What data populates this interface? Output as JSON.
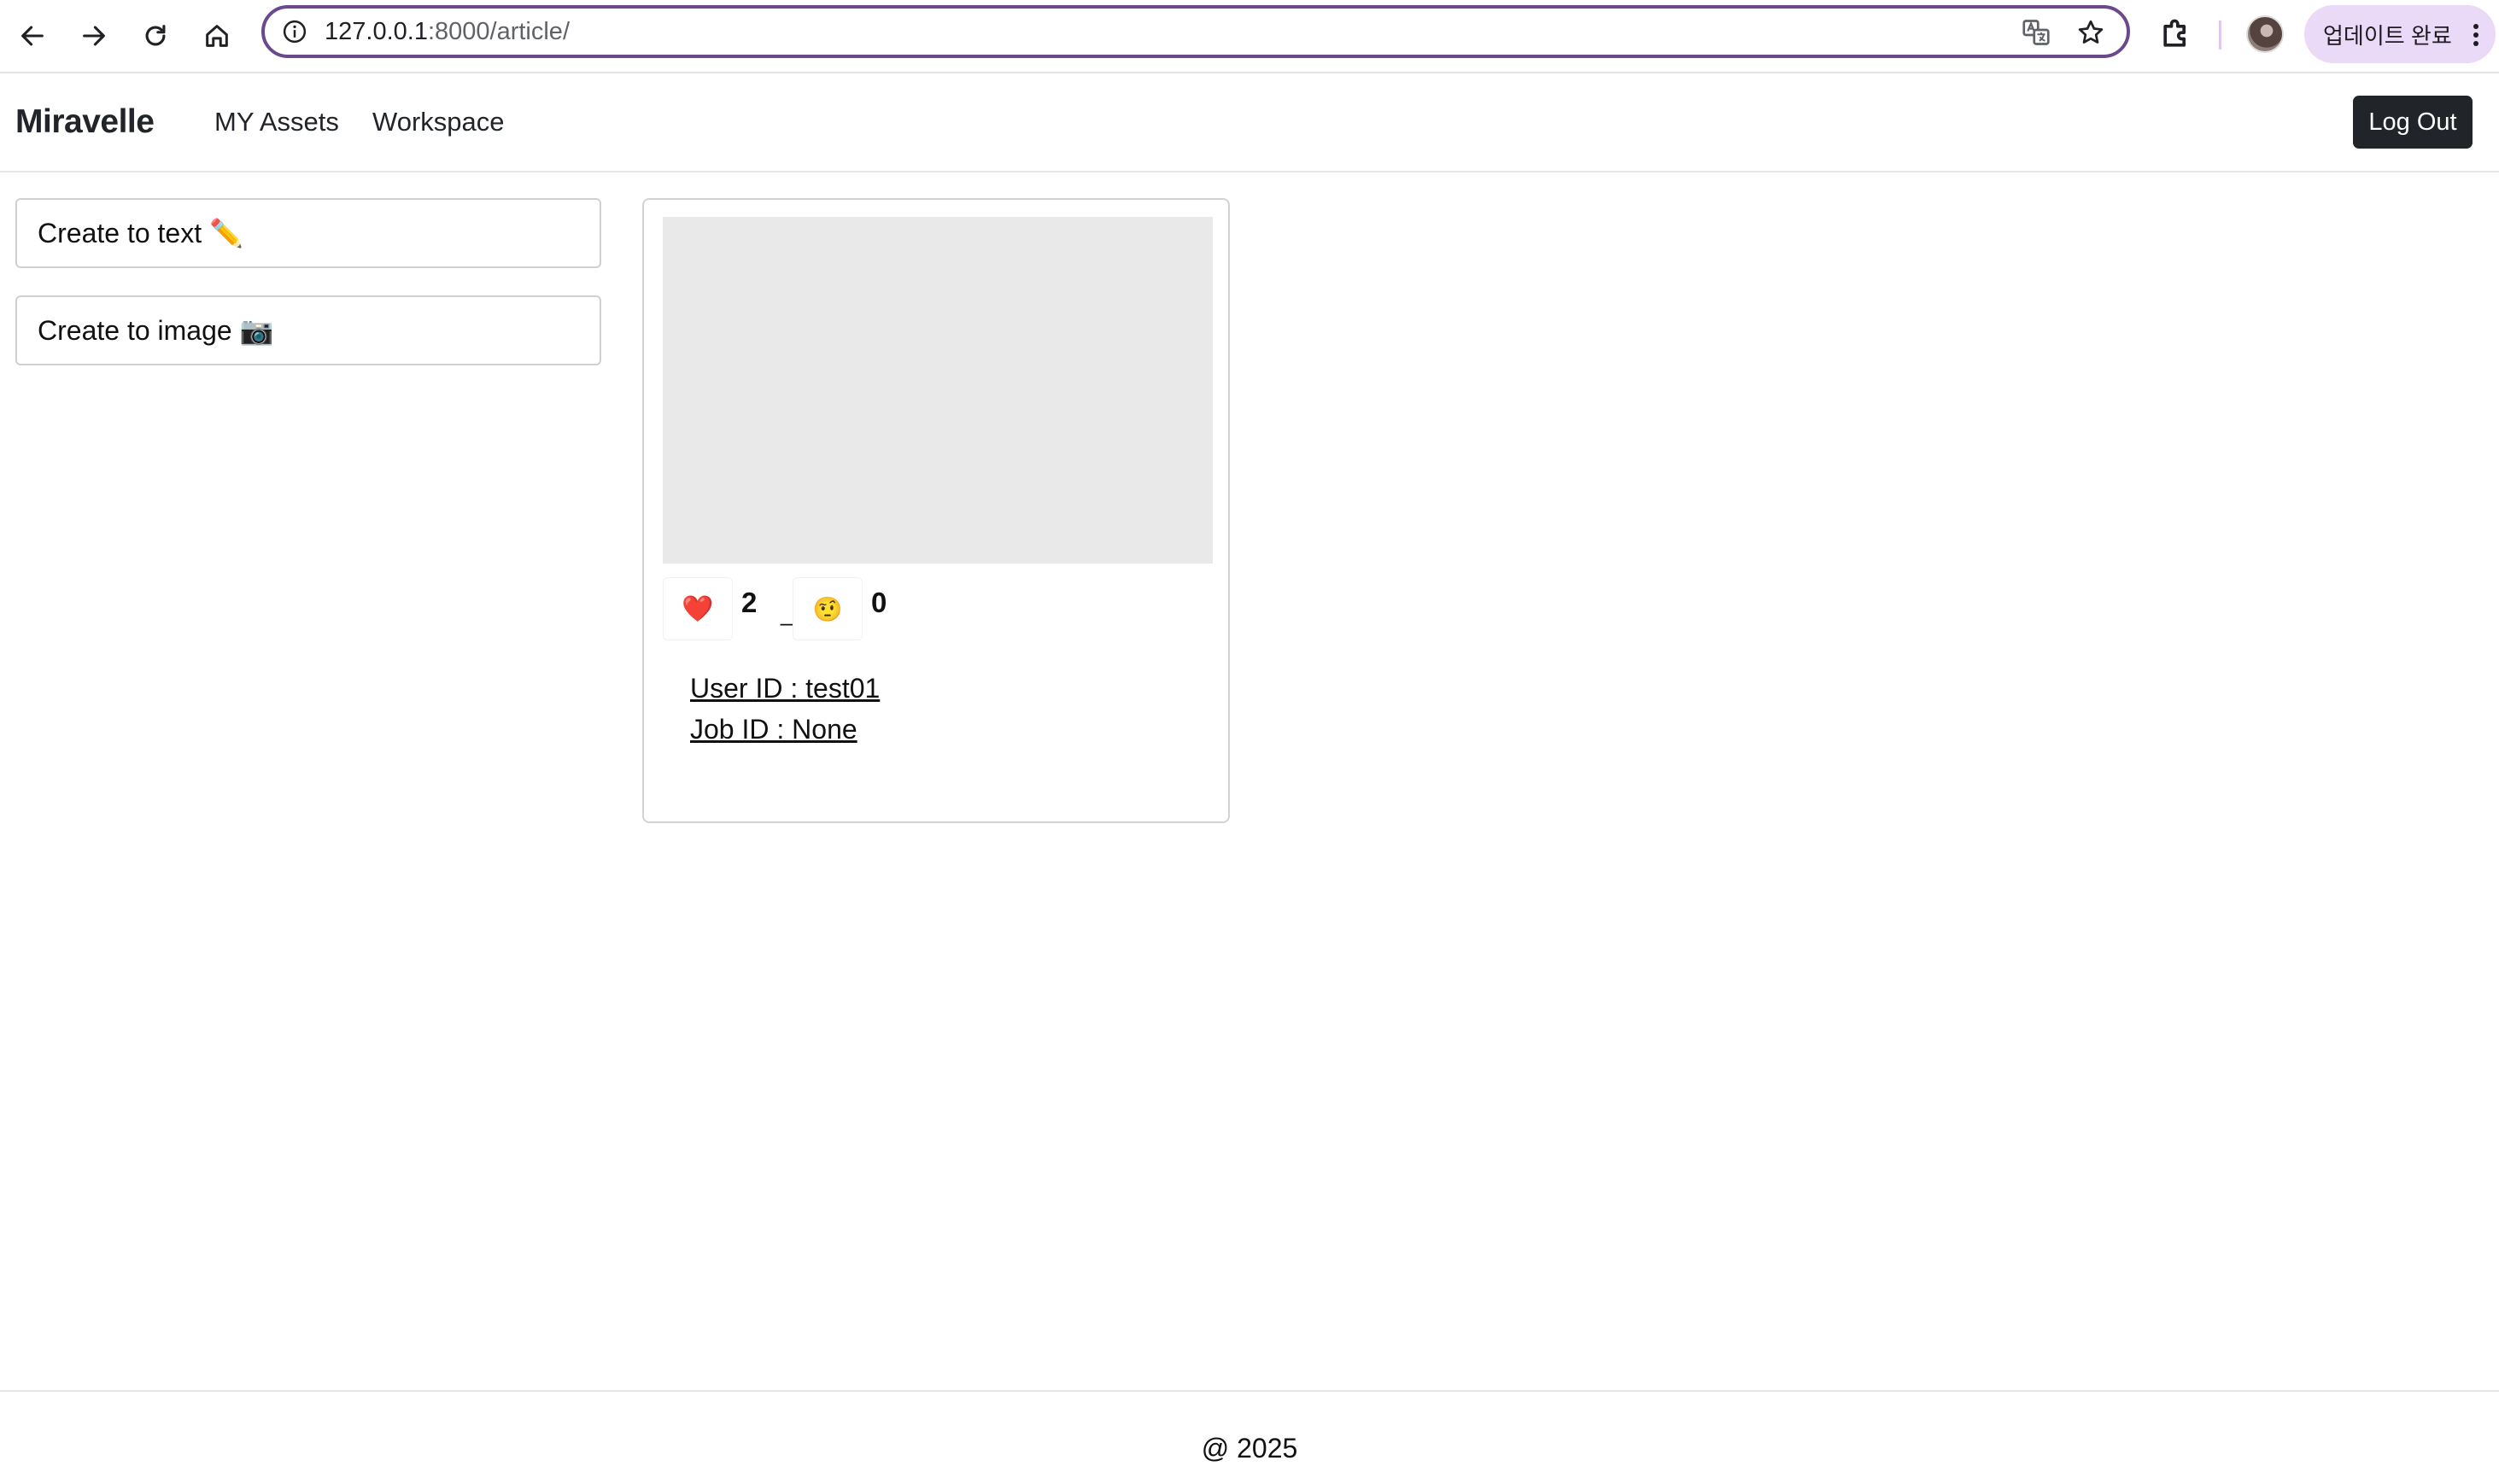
{
  "browser": {
    "url_host": "127.0.0.1",
    "url_rest": ":8000/article/",
    "update_chip_label": "업데이트 완료"
  },
  "site": {
    "brand": "Miravelle",
    "nav": [
      "MY Assets",
      "Workspace"
    ],
    "logout_label": "Log Out"
  },
  "sidebar": {
    "buttons": [
      {
        "label": "Create to text ✏️"
      },
      {
        "label": "Create to image 📷"
      }
    ]
  },
  "card": {
    "reactions": [
      {
        "emoji": "❤️",
        "icon": "heart-icon",
        "count": "2"
      },
      {
        "emoji": "🤨",
        "icon": "skeptical-face-icon",
        "count": "0"
      }
    ],
    "separator": "_",
    "user_id_text": "User ID : test01",
    "job_id_text": "Job ID : None"
  },
  "footer": {
    "text": "@ 2025"
  }
}
